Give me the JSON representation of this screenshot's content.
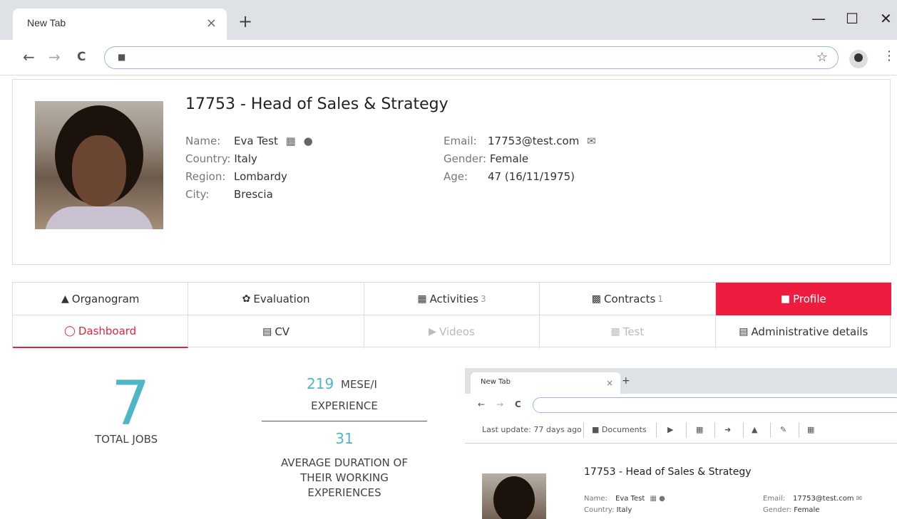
{
  "browser": {
    "tab_title": "New Tab",
    "tab_close": "×",
    "new_tab": "+",
    "minimize": "—",
    "maximize": "☐",
    "close": "✕",
    "back": "←",
    "forward": "→",
    "reload": "C",
    "lock": "🔒",
    "star": "☆",
    "menu": "⋮"
  },
  "profile": {
    "title": "17753 - Head of Sales & Strategy",
    "name_label": "Name:",
    "name": "Eva Test",
    "country_label": "Country:",
    "country": "Italy",
    "region_label": "Region:",
    "region": "Lombardy",
    "city_label": "City:",
    "city": "Brescia",
    "email_label": "Email:",
    "email": "17753@test.com",
    "gender_label": "Gender:",
    "gender": "Female",
    "age_label": "Age:",
    "age": "47 (16/11/1975)"
  },
  "nav": {
    "organogram": "Organogram",
    "evaluation": "Evaluation",
    "activities": "Activities",
    "activities_count": "3",
    "contracts": "Contracts",
    "contracts_count": "1",
    "profile": "Profile",
    "dashboard": "Dashboard",
    "cv": "CV",
    "videos": "Videos",
    "test": "Test",
    "administrative": "Administrative details"
  },
  "stats": {
    "total_jobs": "7",
    "total_jobs_label": "TOTAL JOBS",
    "months_value": "219",
    "months_unit": "MESE/I",
    "experience_label": "EXPERIENCE",
    "avg_value": "31",
    "avg_label_1": "AVERAGE DURATION OF",
    "avg_label_2": "THEIR WORKING",
    "avg_label_3": "EXPERIENCES"
  },
  "mini": {
    "tab_title": "New Tab",
    "last_update": "Last update: 77 days ago",
    "documents": "Documents",
    "title": "17753 - Head of Sales & Strategy",
    "name_label": "Name:",
    "name": "Eva Test",
    "country_label": "Country:",
    "country": "Italy",
    "email_label": "Email:",
    "email": "17753@test.com",
    "gender_label": "Gender:",
    "gender": "Female"
  },
  "colors": {
    "accent": "#ee1d3f",
    "stat": "#4fb6c8"
  }
}
